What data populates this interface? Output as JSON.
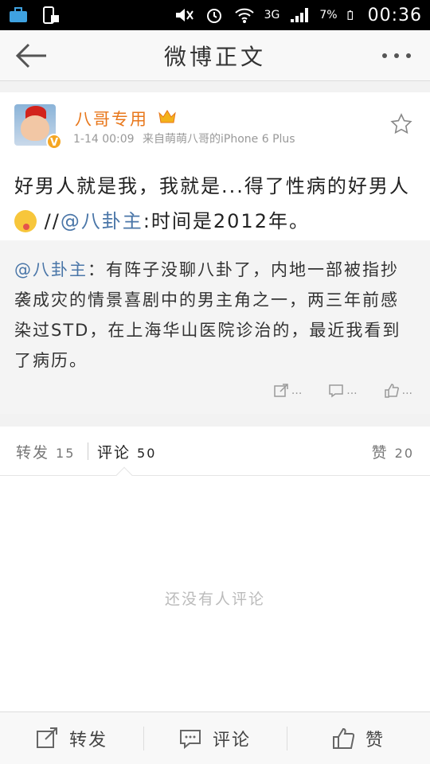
{
  "status_bar": {
    "network": "3G",
    "battery": "7%",
    "time": "00:36",
    "icons": [
      "briefcase-icon",
      "phone-lock-icon",
      "mute-icon",
      "alarm-icon",
      "wifi-icon",
      "signal-icon",
      "battery-icon"
    ]
  },
  "header": {
    "title": "微博正文"
  },
  "post": {
    "username": "八哥专用",
    "time": "1-14 00:09",
    "source": "来自萌萌八哥的iPhone 6 Plus",
    "text_part1": "好男人就是我，我就是...得了性病的好男人",
    "text_part2": " //",
    "mention": "@八卦主",
    "text_part3": ":时间是2012年。",
    "colors": {
      "username": "#e8771b",
      "mention": "#4a76a8"
    }
  },
  "repost": {
    "mention": "@八卦主",
    "text": "：有阵子没聊八卦了，内地一部被指抄袭成灾的情景喜剧中的男主角之一，两三年前感染过STD，在上海华山医院诊治的，最近我看到了病历。",
    "forward_label": "...",
    "comment_label": "...",
    "like_label": "..."
  },
  "tabs": {
    "forward_label": "转发",
    "forward_count": "15",
    "comment_label": "评论",
    "comment_count": "50",
    "like_label": "赞",
    "like_count": "20"
  },
  "comments": {
    "empty_text": "还没有人评论"
  },
  "bottom_bar": {
    "forward": "转发",
    "comment": "评论",
    "like": "赞"
  }
}
